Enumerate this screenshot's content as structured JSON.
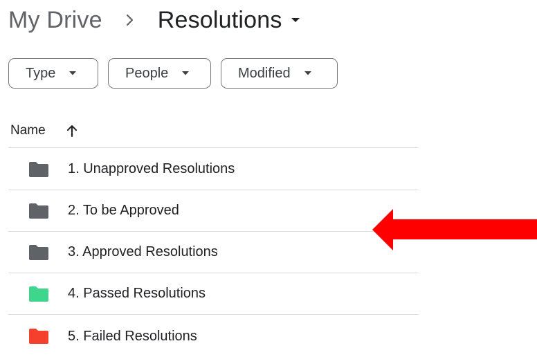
{
  "breadcrumb": {
    "root": "My Drive",
    "current": "Resolutions"
  },
  "filters": {
    "type_label": "Type",
    "people_label": "People",
    "modified_label": "Modified"
  },
  "list": {
    "header_name": "Name",
    "sort_direction": "ascending",
    "rows": [
      {
        "label": "1. Unapproved Resolutions",
        "folder_color": "#5f6368"
      },
      {
        "label": "2. To be Approved",
        "folder_color": "#5f6368"
      },
      {
        "label": "3. Approved Resolutions",
        "folder_color": "#5f6368"
      },
      {
        "label": "4. Passed Resolutions",
        "folder_color": "#3dd68c"
      },
      {
        "label": "5. Failed Resolutions",
        "folder_color": "#f4402c"
      }
    ]
  },
  "annotation": {
    "arrow_color": "#ff0000"
  }
}
